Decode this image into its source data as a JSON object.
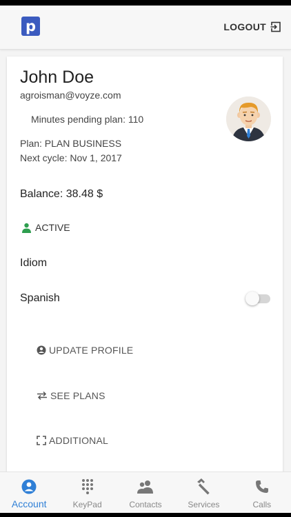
{
  "header": {
    "logo_letter": "p",
    "logout_label": "LOGOUT"
  },
  "profile": {
    "name": "John Doe",
    "email": "agroisman@voyze.com",
    "minutes_pending": "Minutes pending plan: 110",
    "plan": "Plan: PLAN BUSINESS",
    "next_cycle": "Next cycle: Nov 1, 2017",
    "balance": "Balance: 38.48 $",
    "status": "ACTIVE",
    "status_color": "#2e9e4f"
  },
  "settings": {
    "idiom_label": "Idiom",
    "language_label": "Spanish",
    "language_toggle_on": false
  },
  "actions": {
    "update_profile": "UPDATE PROFILE",
    "see_plans": "SEE PLANS",
    "additional": "ADDITIONAL"
  },
  "tabs": [
    {
      "label": "Account",
      "icon": "account-icon",
      "active": true
    },
    {
      "label": "KeyPad",
      "icon": "keypad-icon",
      "active": false
    },
    {
      "label": "Contacts",
      "icon": "contacts-icon",
      "active": false
    },
    {
      "label": "Services",
      "icon": "hammer-icon",
      "active": false
    },
    {
      "label": "Calls",
      "icon": "phone-icon",
      "active": false
    }
  ],
  "colors": {
    "accent": "#2f7fd6",
    "logo_bg": "#3b5bbf"
  }
}
